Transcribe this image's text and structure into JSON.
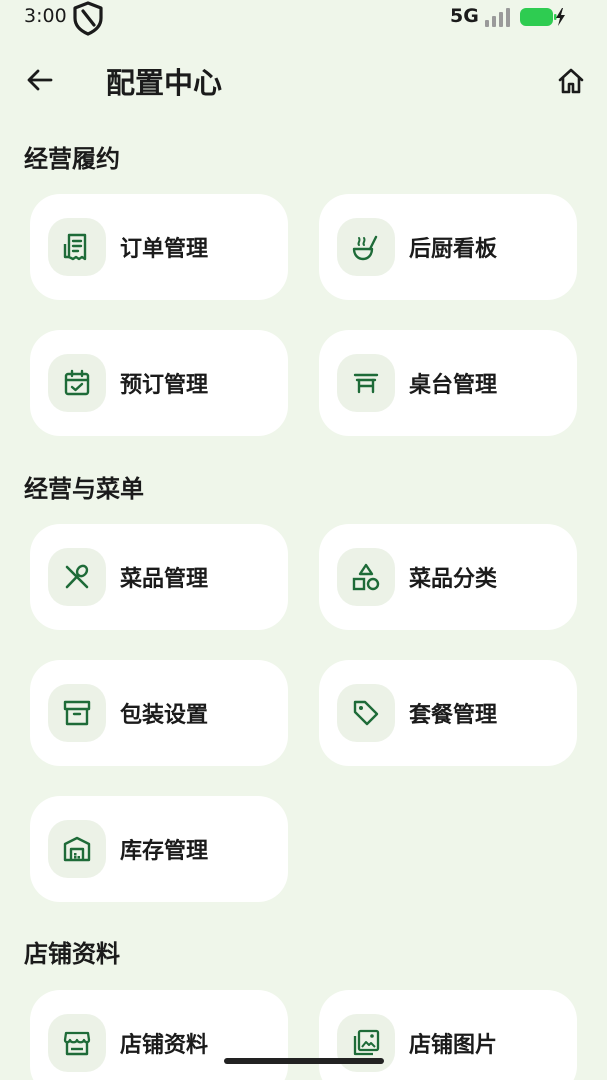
{
  "status_bar": {
    "time": "3:00",
    "network": "5G",
    "battery_color": "#2ecc51"
  },
  "app_bar": {
    "title": "配置中心",
    "back_icon": "arrow-left-icon",
    "home_icon": "home-icon"
  },
  "sections": [
    {
      "title": "经营履约",
      "items": [
        {
          "label": "订单管理",
          "icon": "receipt-icon"
        },
        {
          "label": "后厨看板",
          "icon": "soup-ladle-icon"
        },
        {
          "label": "预订管理",
          "icon": "calendar-check-icon"
        },
        {
          "label": "桌台管理",
          "icon": "table-icon"
        }
      ]
    },
    {
      "title": "经营与菜单",
      "items": [
        {
          "label": "菜品管理",
          "icon": "utensils-icon"
        },
        {
          "label": "菜品分类",
          "icon": "shapes-icon"
        },
        {
          "label": "包装设置",
          "icon": "archive-box-icon"
        },
        {
          "label": "套餐管理",
          "icon": "tag-icon"
        },
        {
          "label": "库存管理",
          "icon": "warehouse-icon"
        }
      ]
    },
    {
      "title": "店铺资料",
      "items": [
        {
          "label": "店铺资料",
          "icon": "storefront-icon"
        },
        {
          "label": "店铺图片",
          "icon": "gallery-icon"
        }
      ]
    }
  ],
  "colors": {
    "background": "#eff6ea",
    "card": "#ffffff",
    "icon_bg": "#ecf2e7",
    "accent": "#1e6b38"
  }
}
